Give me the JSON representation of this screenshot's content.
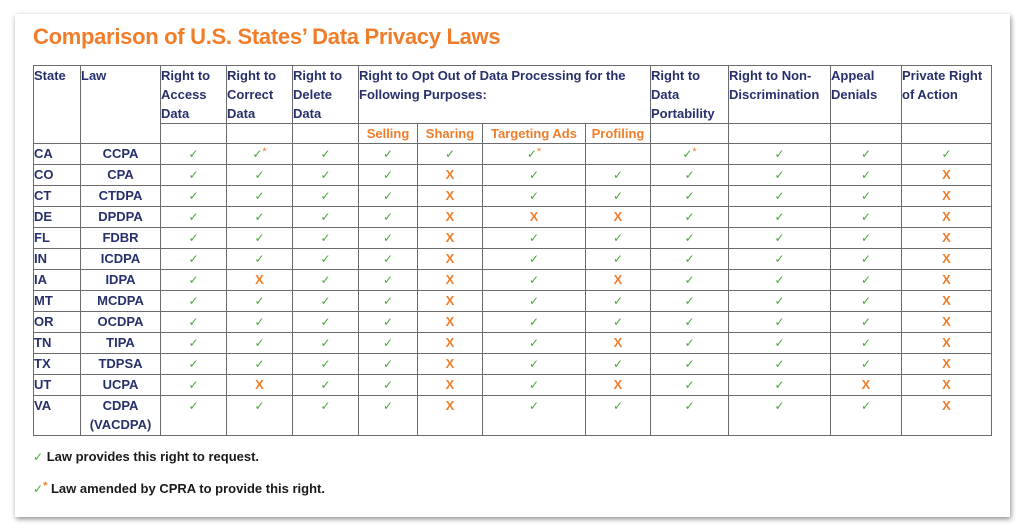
{
  "title": "Comparison of U.S. States’ Data Privacy Laws",
  "colors": {
    "accent_orange": "#f07d2a",
    "header_navy": "#27306b",
    "check_green": "#4aa63c"
  },
  "icons": {
    "check": "✓",
    "no": "X",
    "amended_marker": "*"
  },
  "table": {
    "headers": {
      "state": "State",
      "law": "Law",
      "access": "Right to Access Data",
      "correct": "Right to Correct Data",
      "delete": "Right to Delete Data",
      "optout": "Right to Opt Out of Data Processing for the Following Purposes:",
      "portability": "Right to Data Portability",
      "nondiscrimination": "Right to Non-Discrimination",
      "appeal": "Appeal Denials",
      "private_action": "Private Right of Action"
    },
    "optout_subheaders": [
      "Selling",
      "Sharing",
      "Targeting Ads",
      "Profiling"
    ],
    "value_legend": {
      "Y": "check",
      "Y*": "check with asterisk (amended by CPRA)",
      "N": "X",
      "": "blank"
    },
    "rows": [
      {
        "state": "CA",
        "law": "CCPA",
        "values": [
          "Y",
          "Y*",
          "Y",
          "Y",
          "Y",
          "Y*",
          "",
          "Y*",
          "Y",
          "Y",
          "Y"
        ]
      },
      {
        "state": "CO",
        "law": "CPA",
        "values": [
          "Y",
          "Y",
          "Y",
          "Y",
          "N",
          "Y",
          "Y",
          "Y",
          "Y",
          "Y",
          "N"
        ]
      },
      {
        "state": "CT",
        "law": "CTDPA",
        "values": [
          "Y",
          "Y",
          "Y",
          "Y",
          "N",
          "Y",
          "Y",
          "Y",
          "Y",
          "Y",
          "N"
        ]
      },
      {
        "state": "DE",
        "law": "DPDPA",
        "values": [
          "Y",
          "Y",
          "Y",
          "Y",
          "N",
          "N",
          "N",
          "Y",
          "Y",
          "Y",
          "N"
        ]
      },
      {
        "state": "FL",
        "law": "FDBR",
        "values": [
          "Y",
          "Y",
          "Y",
          "Y",
          "N",
          "Y",
          "Y",
          "Y",
          "Y",
          "Y",
          "N"
        ]
      },
      {
        "state": "IN",
        "law": "ICDPA",
        "values": [
          "Y",
          "Y",
          "Y",
          "Y",
          "N",
          "Y",
          "Y",
          "Y",
          "Y",
          "Y",
          "N"
        ]
      },
      {
        "state": "IA",
        "law": "IDPA",
        "values": [
          "Y",
          "N",
          "Y",
          "Y",
          "N",
          "Y",
          "N",
          "Y",
          "Y",
          "Y",
          "N"
        ]
      },
      {
        "state": "MT",
        "law": "MCDPA",
        "values": [
          "Y",
          "Y",
          "Y",
          "Y",
          "N",
          "Y",
          "Y",
          "Y",
          "Y",
          "Y",
          "N"
        ]
      },
      {
        "state": "OR",
        "law": "OCDPA",
        "values": [
          "Y",
          "Y",
          "Y",
          "Y",
          "N",
          "Y",
          "Y",
          "Y",
          "Y",
          "Y",
          "N"
        ]
      },
      {
        "state": "TN",
        "law": "TIPA",
        "values": [
          "Y",
          "Y",
          "Y",
          "Y",
          "N",
          "Y",
          "N",
          "Y",
          "Y",
          "Y",
          "N"
        ]
      },
      {
        "state": "TX",
        "law": "TDPSA",
        "values": [
          "Y",
          "Y",
          "Y",
          "Y",
          "N",
          "Y",
          "Y",
          "Y",
          "Y",
          "Y",
          "N"
        ]
      },
      {
        "state": "UT",
        "law": "UCPA",
        "values": [
          "Y",
          "N",
          "Y",
          "Y",
          "N",
          "Y",
          "N",
          "Y",
          "Y",
          "N",
          "N"
        ]
      },
      {
        "state": "VA",
        "law": "CDPA (VACDPA)",
        "law_line1": "CDPA",
        "law_line2": "(VACDPA)",
        "values": [
          "Y",
          "Y",
          "Y",
          "Y",
          "N",
          "Y",
          "Y",
          "Y",
          "Y",
          "Y",
          "N"
        ]
      }
    ]
  },
  "legend": {
    "check_text": "Law provides this right to request.",
    "amended_text": "Law amended by CPRA to provide this right."
  }
}
